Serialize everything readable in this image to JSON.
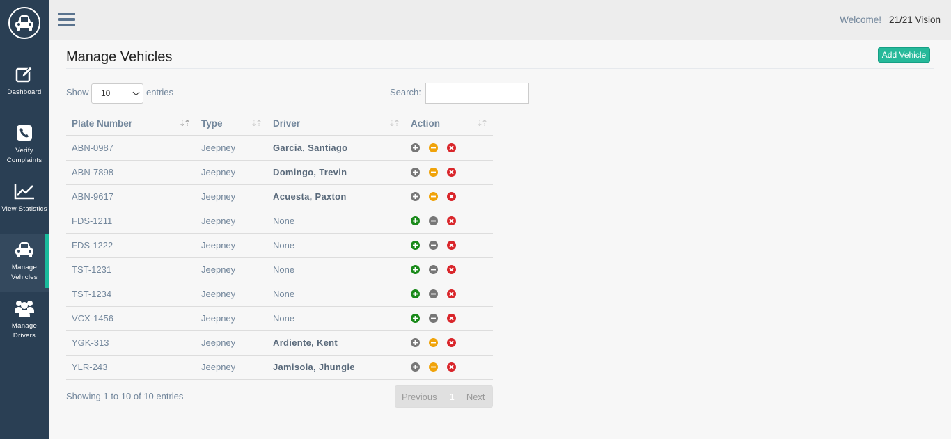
{
  "header": {
    "welcome": "Welcome!",
    "user": "21/21 Vision"
  },
  "sidebar": {
    "logo": "car-logo-icon",
    "items": [
      {
        "label": "Dashboard",
        "icon": "edit-icon",
        "active": false
      },
      {
        "label": "Verify Complaints",
        "icon": "phone-icon",
        "active": false
      },
      {
        "label": "View Statistics",
        "icon": "line-chart-icon",
        "active": false
      },
      {
        "label": "Manage Vehicles",
        "icon": "car-icon",
        "active": true
      },
      {
        "label": "Manage Drivers",
        "icon": "users-icon",
        "active": false
      }
    ]
  },
  "page": {
    "title": "Manage Vehicles",
    "add_button": "Add Vehicle"
  },
  "table_controls": {
    "show": "Show",
    "entries_value": "10",
    "entries": "entries",
    "search": "Search:"
  },
  "table": {
    "columns": [
      "Plate Number",
      "Type",
      "Driver",
      "Action"
    ],
    "rows": [
      {
        "plate": "ABN-0987",
        "type": "Jeepney",
        "driver": "Garcia, Santiago",
        "assigned": true
      },
      {
        "plate": "ABN-7898",
        "type": "Jeepney",
        "driver": "Domingo, Trevin",
        "assigned": true
      },
      {
        "plate": "ABN-9617",
        "type": "Jeepney",
        "driver": "Acuesta, Paxton",
        "assigned": true
      },
      {
        "plate": "FDS-1211",
        "type": "Jeepney",
        "driver": "None",
        "assigned": false
      },
      {
        "plate": "FDS-1222",
        "type": "Jeepney",
        "driver": "None",
        "assigned": false
      },
      {
        "plate": "TST-1231",
        "type": "Jeepney",
        "driver": "None",
        "assigned": false
      },
      {
        "plate": "TST-1234",
        "type": "Jeepney",
        "driver": "None",
        "assigned": false
      },
      {
        "plate": "VCX-1456",
        "type": "Jeepney",
        "driver": "None",
        "assigned": false
      },
      {
        "plate": "YGK-313",
        "type": "Jeepney",
        "driver": "Ardiente, Kent",
        "assigned": true
      },
      {
        "plate": "YLR-243",
        "type": "Jeepney",
        "driver": "Jamisola, Jhungie",
        "assigned": true
      }
    ]
  },
  "footer": {
    "info": "Showing 1 to 10 of 10 entries",
    "previous": "Previous",
    "page": "1",
    "next": "Next"
  },
  "colors": {
    "sidebar": "#2a3f54",
    "accent": "#1abb9c",
    "add_green": "#26b99a",
    "assign_green": "#1a8a1a",
    "unassign_orange": "#f0a30a",
    "delete_red": "#d9262b",
    "disabled_gray": "#777777"
  }
}
